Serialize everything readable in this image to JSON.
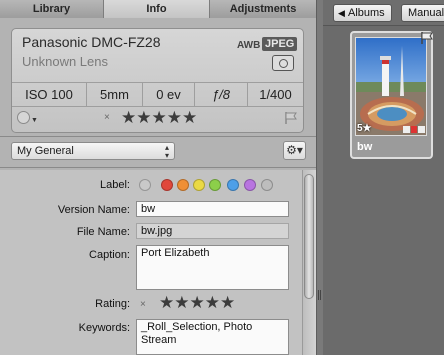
{
  "tabs": [
    {
      "label": "Library",
      "active": false
    },
    {
      "label": "Info",
      "active": true
    },
    {
      "label": "Adjustments",
      "active": false
    }
  ],
  "camera": {
    "model": "Panasonic DMC-FZ28",
    "lens": "Unknown Lens",
    "awb": "AWB",
    "format_badge": "JPEG",
    "icon": "camera-mode-icon"
  },
  "exif": [
    {
      "value": "ISO 100"
    },
    {
      "value": "5mm"
    },
    {
      "value": "0 ev"
    },
    {
      "value": "ƒ/8"
    },
    {
      "value": "1/400"
    }
  ],
  "rating_row": {
    "clear": "×",
    "stars": "★★★★★",
    "flag_icon": "flag-icon",
    "label_dot_icon": "color-label-icon"
  },
  "preset": {
    "selected": "My General",
    "gear_icon": "gear-icon"
  },
  "metadata": {
    "label_label": "Label:",
    "label_colors": [
      "#c9c9c9",
      "#e0473b",
      "#ef8f35",
      "#ead944",
      "#8ccf4a",
      "#4d9fe8",
      "#b874e0",
      "#bdbdbd"
    ],
    "version_name_label": "Version Name:",
    "version_name_value": "bw",
    "file_name_label": "File Name:",
    "file_name_value": "bw.jpg",
    "caption_label": "Caption:",
    "caption_value": "Port Elizabeth",
    "rating_label": "Rating:",
    "rating_clear": "×",
    "rating_stars": "★★★★★",
    "keywords_label": "Keywords:",
    "keywords_line1": "_Roll_Selection, Photo",
    "keywords_line2": "Stream"
  },
  "browser": {
    "back_button": "Albums",
    "manual_button": "Manual",
    "thumbnail": {
      "name": "bw",
      "rating": "5★"
    }
  }
}
